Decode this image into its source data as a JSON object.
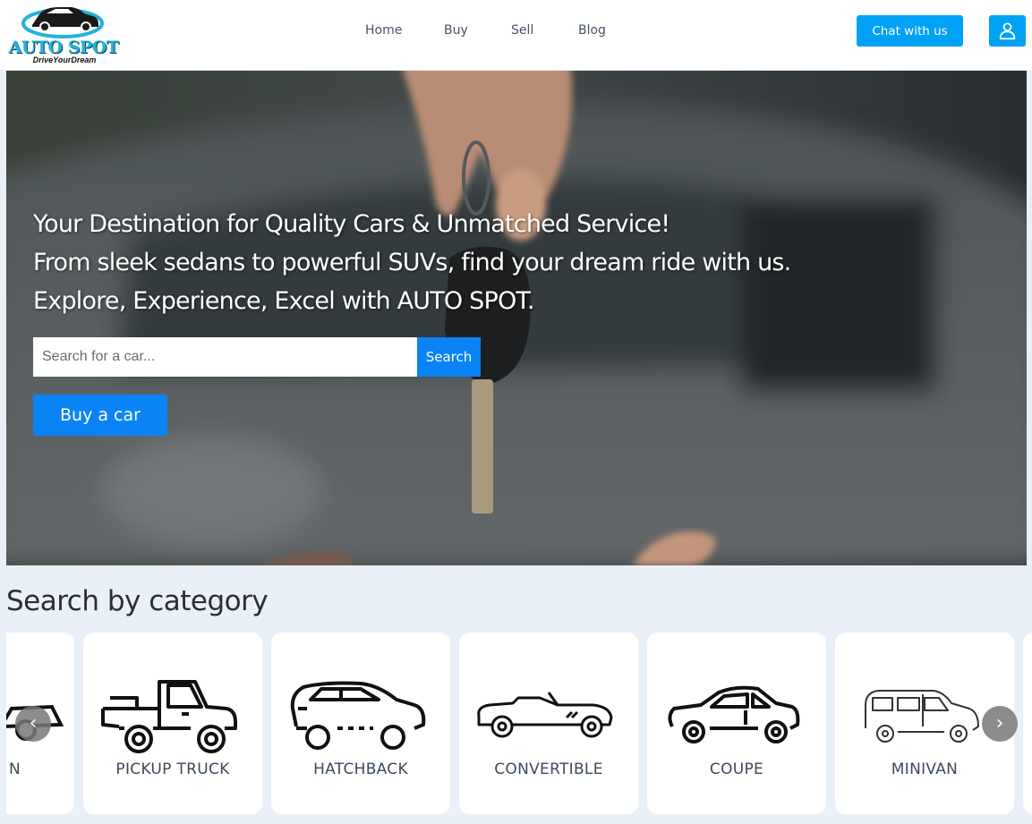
{
  "brand": {
    "name": "AUTO SPOT",
    "tagline": "DriveYourDream"
  },
  "nav": {
    "items": [
      {
        "label": "Home"
      },
      {
        "label": "Buy"
      },
      {
        "label": "Sell"
      },
      {
        "label": "Blog"
      }
    ]
  },
  "header": {
    "chat_label": "Chat with us",
    "user_icon": "user-icon"
  },
  "hero": {
    "lines": [
      "Your Destination for Quality Cars & Unmatched Service!",
      "From sleek sedans to powerful SUVs, find your dream ride with us.",
      "Explore, Experience, Excel with AUTO SPOT."
    ],
    "search_placeholder": "Search for a car...",
    "search_value": "",
    "search_button": "Search",
    "buy_button": "Buy a car"
  },
  "category": {
    "title": "Search by category",
    "items": [
      {
        "label": "N",
        "icon": "car-icon"
      },
      {
        "label": "PICKUP TRUCK",
        "icon": "pickup-truck-icon"
      },
      {
        "label": "HATCHBACK",
        "icon": "hatchback-icon"
      },
      {
        "label": "CONVERTIBLE",
        "icon": "convertible-icon"
      },
      {
        "label": "COUPE",
        "icon": "coupe-icon"
      },
      {
        "label": "MINIVAN",
        "icon": "minivan-icon"
      }
    ],
    "prev_icon": "chevron-left-icon",
    "next_icon": "chevron-right-icon"
  },
  "colors": {
    "accent": "#00a2f5",
    "primary": "#0a84f5",
    "page_bg": "#eaf0f8"
  }
}
